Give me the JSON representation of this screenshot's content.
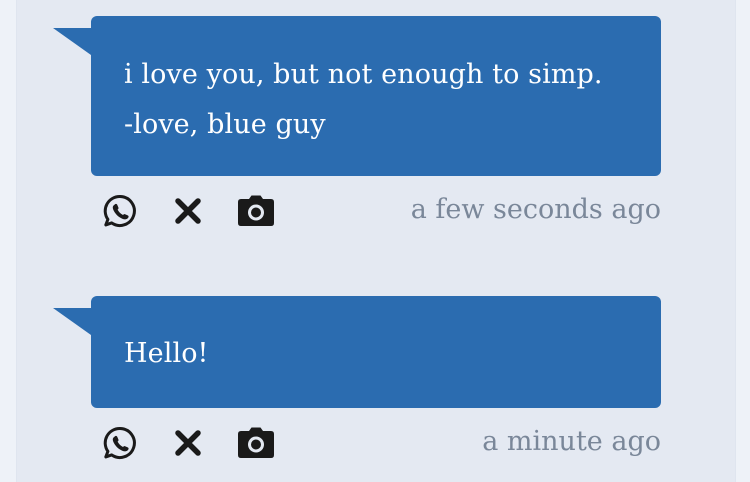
{
  "colors": {
    "page_background": "#eef2f8",
    "feed_background": "#e4e9f2",
    "bubble": "#2b6cb0",
    "bubble_text": "#ffffff",
    "icon": "#1a1a1a",
    "timestamp": "#7a8799"
  },
  "posts": [
    {
      "lines": [
        "i love you, but not enough to simp.",
        "-love, blue guy"
      ],
      "timestamp": "a few seconds ago",
      "actions": [
        "whatsapp-icon",
        "x-icon",
        "camera-icon"
      ]
    },
    {
      "lines": [
        "Hello!"
      ],
      "timestamp": "a minute ago",
      "actions": [
        "whatsapp-icon",
        "x-icon",
        "camera-icon"
      ]
    }
  ]
}
